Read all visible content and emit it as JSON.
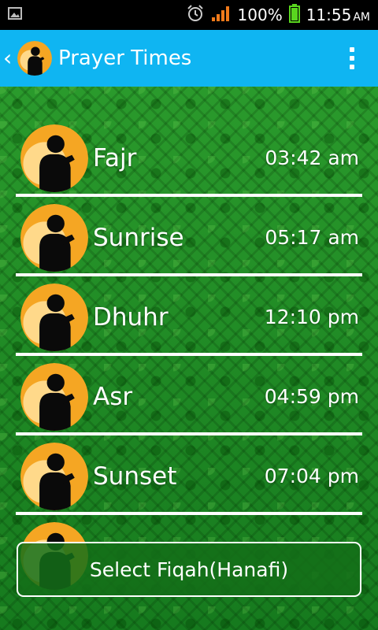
{
  "status_bar": {
    "battery_percent": "100%",
    "time": "11:55",
    "ampm": "AM"
  },
  "app_bar": {
    "title": "Prayer Times"
  },
  "prayers": [
    {
      "name": "Fajr",
      "time": "03:42 am"
    },
    {
      "name": "Sunrise",
      "time": "05:17 am"
    },
    {
      "name": "Dhuhr",
      "time": "12:10 pm"
    },
    {
      "name": "Asr",
      "time": "04:59 pm"
    },
    {
      "name": "Sunset",
      "time": "07:04 pm"
    }
  ],
  "select_button": {
    "label": "Select Fiqah(Hanafi)"
  },
  "colors": {
    "app_bar": "#0fb5f2",
    "background_green": "#1e8a25",
    "icon_orange": "#f5a623"
  }
}
